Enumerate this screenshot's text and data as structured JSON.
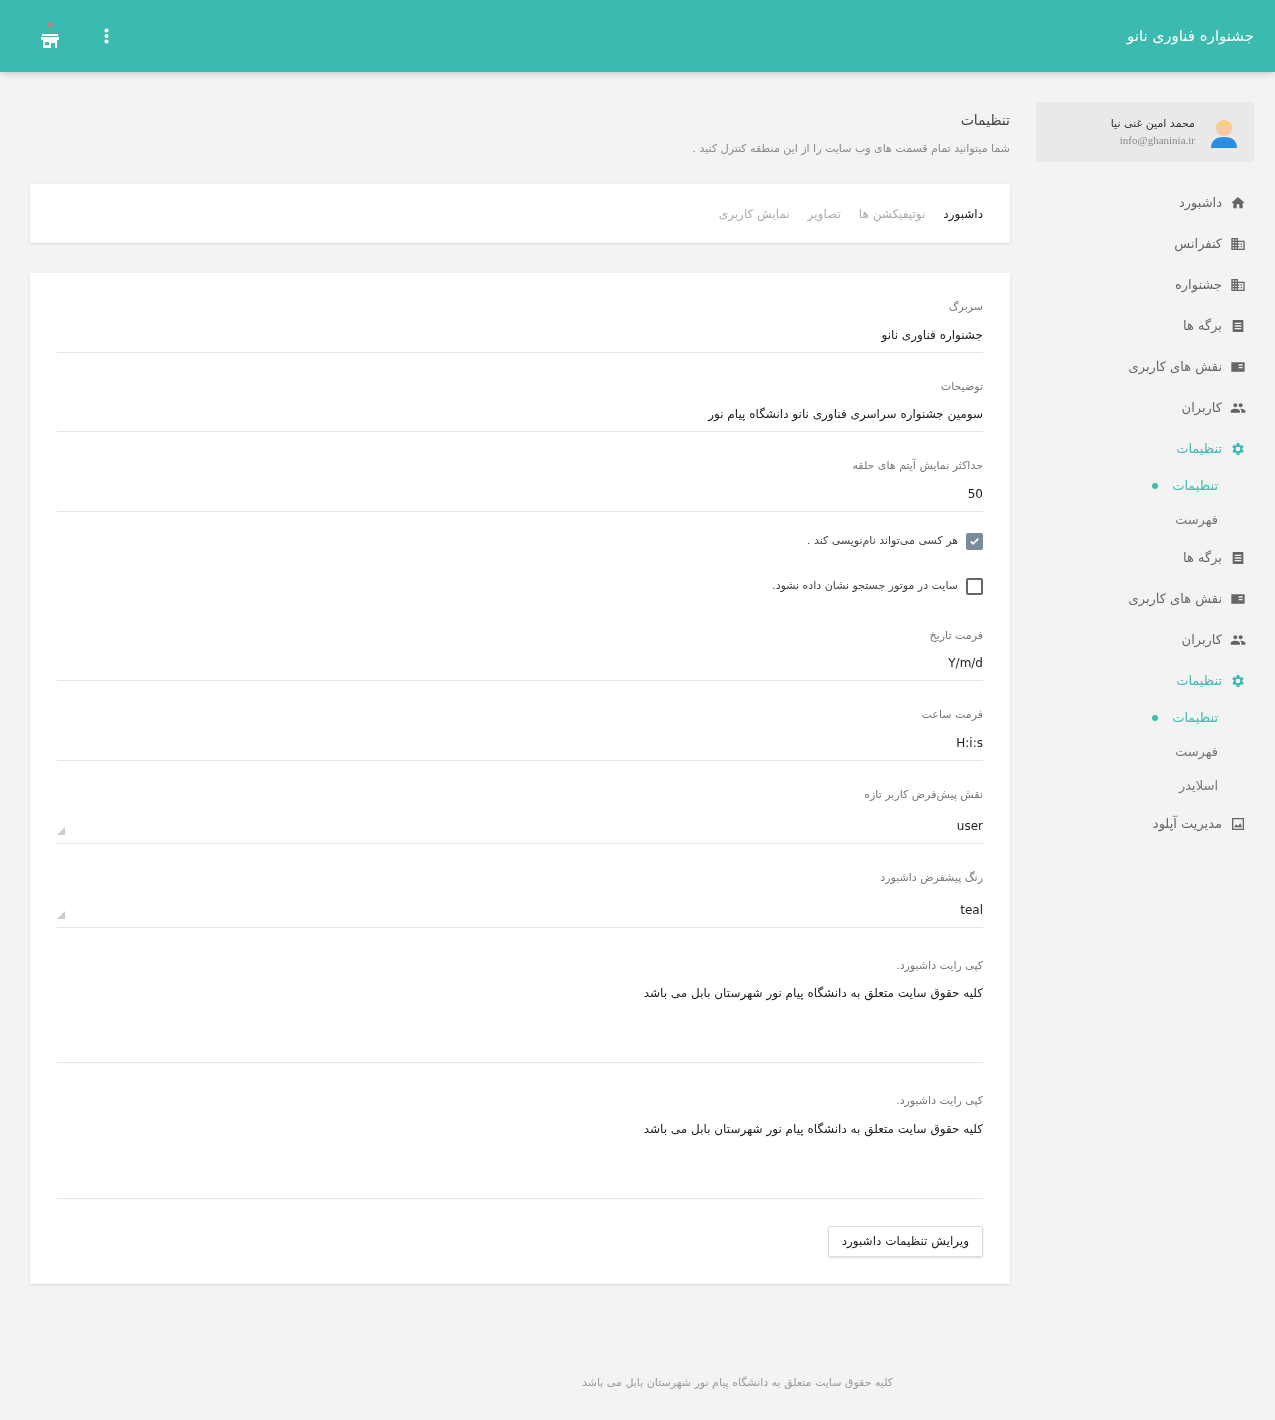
{
  "header": {
    "title": "جشنواره فناوری نانو"
  },
  "user": {
    "name": "محمد امین غنی نیا",
    "email": "info@ghaninia.ir"
  },
  "sidebar": {
    "items": [
      {
        "kind": "home",
        "label": "داشبورد",
        "selected": false
      },
      {
        "kind": "building",
        "label": "کنفرانس",
        "selected": false
      },
      {
        "kind": "building",
        "label": "جشنواره",
        "selected": false
      },
      {
        "kind": "list",
        "label": "برگه ها",
        "selected": false
      },
      {
        "kind": "roles",
        "label": "نقش های کاربری",
        "selected": false
      },
      {
        "kind": "users",
        "label": "کاربران",
        "selected": false
      },
      {
        "kind": "settings",
        "label": "تنظیمات",
        "selected": true,
        "children": [
          {
            "label": "تنظیمات",
            "selected": true
          },
          {
            "label": "فهرست",
            "selected": false
          }
        ]
      },
      {
        "kind": "list",
        "label": "برگه ها",
        "selected": false
      },
      {
        "kind": "roles",
        "label": "نقش های کاربری",
        "selected": false
      },
      {
        "kind": "users",
        "label": "کاربران",
        "selected": false
      },
      {
        "kind": "settings",
        "label": "تنظیمات",
        "selected": true,
        "children": [
          {
            "label": "تنظیمات",
            "selected": true
          },
          {
            "label": "فهرست",
            "selected": false
          },
          {
            "label": "اسلایدر",
            "selected": false
          }
        ]
      },
      {
        "kind": "upload",
        "label": "مدیریت آپلود",
        "selected": false
      }
    ]
  },
  "page": {
    "title": "تنظیمات",
    "subtitle": "شما میتوانید تمام قسمت های وب سایت را از این منطقه کنترل کنید ."
  },
  "tabs": [
    {
      "label": "داشبورد",
      "selected": true
    },
    {
      "label": "نوتیفیکشن ها",
      "selected": false
    },
    {
      "label": "تصاویر",
      "selected": false
    },
    {
      "label": "نمایش کاربری",
      "selected": false
    }
  ],
  "form": {
    "fields": [
      {
        "kind": "text",
        "label": "سربرگ",
        "value": "جشنواره فناوری نانو"
      },
      {
        "kind": "text",
        "label": "توضیحات",
        "value": "سومین جشنواره سراسری فناوری نانو دانشگاه پیام نور"
      },
      {
        "kind": "text",
        "label": "حداکثر نمایش آیتم های حلقه",
        "value": "50"
      },
      {
        "kind": "checkbox",
        "label": "هر کسی می‌تواند نام‌نویسی کند .",
        "checked": true
      },
      {
        "kind": "checkbox",
        "label": "سایت در موتور جستجو نشان داده نشود.",
        "checked": false
      },
      {
        "kind": "text",
        "label": "فرمت تاریخ",
        "value": "Y/m/d"
      },
      {
        "kind": "text",
        "label": "فرمت ساعت",
        "value": "H:i:s"
      },
      {
        "kind": "select",
        "label": "نقش پیش‌فرض کاربر تازه",
        "value": "user"
      },
      {
        "kind": "select",
        "label": "رنگ پیشفرض داشبورد",
        "value": "teal"
      },
      {
        "kind": "textarea",
        "label": "کپی رایت داشبورد.",
        "value": "کلیه حقوق سایت متعلق به دانشگاه پیام نور شهرستان بابل می باشد"
      },
      {
        "kind": "textarea",
        "label": "کپی رایت داشبورد.",
        "value": "کلیه حقوق سایت متعلق به دانشگاه پیام نور شهرستان بابل می باشد"
      }
    ],
    "submit": "ویرایش تنظیمات داشبورد"
  },
  "footer": "کلیه حقوق سایت متعلق به دانشگاه پیام نور شهرستان بابل می باشد"
}
